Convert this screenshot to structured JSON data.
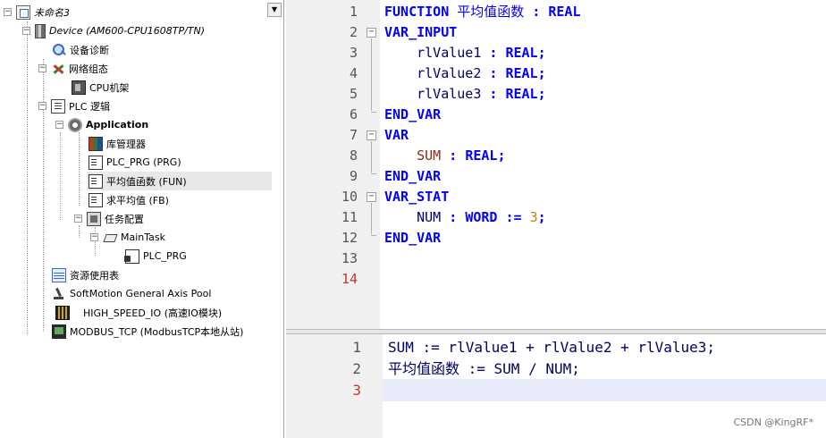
{
  "tree": {
    "dropdown_glyph": "▼",
    "nodes": [
      {
        "label": "未命名3",
        "icon": "project-root-icon"
      },
      {
        "label": "Device (AM600-CPU1608TP/TN)",
        "icon": "device-icon"
      },
      {
        "label": "设备诊断",
        "icon": "diagnostics-icon"
      },
      {
        "label": "网络组态",
        "icon": "network-config-icon"
      },
      {
        "label": "CPU机架",
        "icon": "cpu-rack-icon"
      },
      {
        "label": "PLC 逻辑",
        "icon": "plc-logic-icon"
      },
      {
        "label": "Application",
        "icon": "application-gear-icon"
      },
      {
        "label": "库管理器",
        "icon": "library-manager-icon"
      },
      {
        "label": "PLC_PRG (PRG)",
        "icon": "program-doc-icon"
      },
      {
        "label": "平均值函数 (FUN)",
        "icon": "function-doc-icon"
      },
      {
        "label": "求平均值 (FB)",
        "icon": "function-block-doc-icon"
      },
      {
        "label": "任务配置",
        "icon": "task-config-icon"
      },
      {
        "label": "MainTask",
        "icon": "main-task-icon"
      },
      {
        "label": "PLC_PRG",
        "icon": "program-call-icon"
      },
      {
        "label": "资源使用表",
        "icon": "resource-table-icon"
      },
      {
        "label": "SoftMotion General Axis Pool",
        "icon": "softmotion-axis-icon"
      },
      {
        "label": "HIGH_SPEED_IO (高速IO模块)",
        "icon": "high-speed-io-icon"
      },
      {
        "label": "MODBUS_TCP (ModbusTCP本地从站)",
        "icon": "modbus-tcp-icon"
      }
    ]
  },
  "declaration": {
    "line_numbers": [
      "1",
      "2",
      "3",
      "4",
      "5",
      "6",
      "7",
      "8",
      "9",
      "10",
      "11",
      "12",
      "13",
      "14"
    ],
    "fold_glyph": "−",
    "lines": [
      [
        {
          "t": "FUNCTION",
          "c": "kw"
        },
        {
          "t": " 平均值函数 ",
          "c": "cn"
        },
        {
          "t": ":",
          "c": "pn"
        },
        {
          "t": " ",
          "c": ""
        },
        {
          "t": "REAL",
          "c": "kw"
        }
      ],
      [
        {
          "t": "VAR_INPUT",
          "c": "kw"
        }
      ],
      [
        {
          "t": "    rlValue1 ",
          "c": "id"
        },
        {
          "t": ":",
          "c": "pn"
        },
        {
          "t": " ",
          "c": ""
        },
        {
          "t": "REAL",
          "c": "kw"
        },
        {
          "t": ";",
          "c": "pn"
        }
      ],
      [
        {
          "t": "    rlValue2 ",
          "c": "id"
        },
        {
          "t": ":",
          "c": "pn"
        },
        {
          "t": " ",
          "c": ""
        },
        {
          "t": "REAL",
          "c": "kw"
        },
        {
          "t": ";",
          "c": "pn"
        }
      ],
      [
        {
          "t": "    rlValue3 ",
          "c": "id"
        },
        {
          "t": ":",
          "c": "pn"
        },
        {
          "t": " ",
          "c": ""
        },
        {
          "t": "REAL",
          "c": "kw"
        },
        {
          "t": ";",
          "c": "pn"
        }
      ],
      [
        {
          "t": "END_VAR",
          "c": "kw"
        }
      ],
      [
        {
          "t": "VAR",
          "c": "kw"
        }
      ],
      [
        {
          "t": "    ",
          "c": ""
        },
        {
          "t": "SUM",
          "c": "vr"
        },
        {
          "t": " ",
          "c": ""
        },
        {
          "t": ":",
          "c": "pn"
        },
        {
          "t": " ",
          "c": ""
        },
        {
          "t": "REAL",
          "c": "kw"
        },
        {
          "t": ";",
          "c": "pn"
        }
      ],
      [
        {
          "t": "END_VAR",
          "c": "kw"
        }
      ],
      [
        {
          "t": "VAR_STAT",
          "c": "kw"
        }
      ],
      [
        {
          "t": "    NUM ",
          "c": "id"
        },
        {
          "t": ":",
          "c": "pn"
        },
        {
          "t": " ",
          "c": ""
        },
        {
          "t": "WORD",
          "c": "kw"
        },
        {
          "t": " ",
          "c": ""
        },
        {
          "t": ":=",
          "c": "pn"
        },
        {
          "t": " ",
          "c": ""
        },
        {
          "t": "3",
          "c": "nm"
        },
        {
          "t": ";",
          "c": "pn"
        }
      ],
      [
        {
          "t": "END_VAR",
          "c": "kw"
        }
      ],
      [],
      []
    ]
  },
  "implementation": {
    "line_numbers": [
      "1",
      "2",
      "3"
    ],
    "lines": [
      [
        {
          "t": "SUM := rlValue1 + rlValue2 + rlValue3;",
          "c": "id"
        }
      ],
      [
        {
          "t": "平均值函数 := SUM / NUM;",
          "c": "id"
        }
      ],
      []
    ]
  },
  "watermark": "CSDN @KingRF*",
  "colors": {
    "keyword": "#0000ff",
    "identifier": "#000066",
    "variable": "#8b2a12",
    "number": "#b8860b",
    "error_line_number": "#c0392b"
  }
}
